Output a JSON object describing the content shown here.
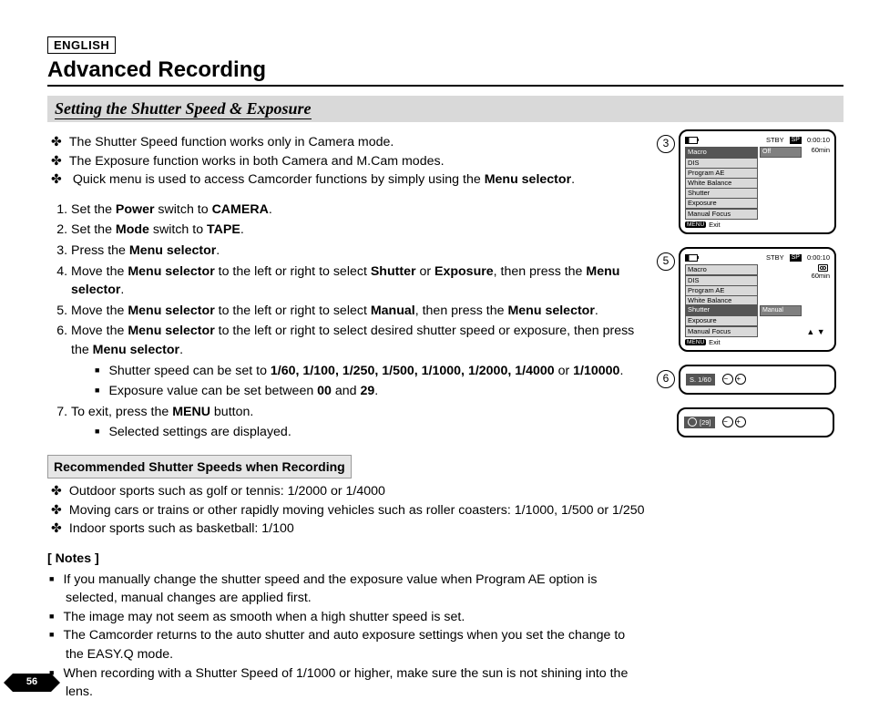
{
  "language_tag": "ENGLISH",
  "title": "Advanced Recording",
  "subtitle": "Setting the Shutter Speed & Exposure",
  "intro": [
    "The Shutter Speed function works only in Camera mode.",
    "The Exposure function works in both Camera and M.Cam modes."
  ],
  "intro3_pre": "Quick menu is used to access Camcorder functions by simply using the ",
  "intro3_bold": "Menu selector",
  "steps": {
    "s1_a": "Set the ",
    "s1_b": "Power",
    "s1_c": " switch to ",
    "s1_d": "CAMERA",
    "s1_e": ".",
    "s2_a": "Set the ",
    "s2_b": "Mode",
    "s2_c": " switch to ",
    "s2_d": "TAPE",
    "s2_e": ".",
    "s3_a": "Press the ",
    "s3_b": "Menu selector",
    "s3_c": ".",
    "s4_a": "Move the ",
    "s4_b": "Menu selector",
    "s4_c": " to the left or right to select ",
    "s4_d": "Shutter",
    "s4_e": " or ",
    "s4_f": "Exposure",
    "s4_g": ", then press the ",
    "s4_h": "Menu selector",
    "s4_i": ".",
    "s5_a": "Move the ",
    "s5_b": "Menu selector",
    "s5_c": " to the left or right to select ",
    "s5_d": "Manual",
    "s5_e": ", then press the ",
    "s5_f": "Menu selector",
    "s5_g": ".",
    "s6_a": "Move the ",
    "s6_b": "Menu selector",
    "s6_c": " to the left or right to select desired shutter speed or exposure, then press the ",
    "s6_d": "Menu selector",
    "s6_e": ".",
    "s6sub1_a": "Shutter speed can be set to ",
    "s6sub1_vals": "1/60, 1/100, 1/250, 1/500, 1/1000, 1/2000, 1/4000",
    "s6sub1_or": " or ",
    "s6sub1_last": "1/10000",
    "s6sub1_dot": ".",
    "s6sub2_a": "Exposure value can be set between ",
    "s6sub2_b": "00",
    "s6sub2_c": " and ",
    "s6sub2_d": "29",
    "s6sub2_e": ".",
    "s7_a": "To exit, press the ",
    "s7_b": "MENU",
    "s7_c": " button.",
    "s7sub": "Selected settings are displayed."
  },
  "rec_heading": "Recommended Shutter Speeds when Recording",
  "rec_items": [
    "Outdoor sports such as golf or tennis: 1/2000 or 1/4000",
    "Moving cars or trains or other rapidly moving vehicles such as roller coasters: 1/1000, 1/500 or 1/250",
    "Indoor sports such as basketball: 1/100"
  ],
  "notes_heading": "[ Notes ]",
  "notes": [
    "If you manually change the shutter speed and the exposure value when Program AE option is selected, manual changes are applied first.",
    "The image may not seem as smooth when a high shutter speed is set.",
    "The Camcorder returns to the auto shutter and auto exposure settings when you set the change to the EASY.Q mode.",
    "When recording with a Shutter Speed of 1/1000 or higher, make sure the sun is not shining into the lens."
  ],
  "page_number": "56",
  "screens": {
    "s3": {
      "num": "3",
      "stby": "STBY",
      "sp": "SP",
      "time": "0:00:10",
      "remain": "60min",
      "items": [
        "Macro",
        "DIS",
        "Program AE",
        "White Balance",
        "Shutter",
        "Exposure",
        "Manual Focus"
      ],
      "sel_index": 0,
      "sel_value": "Off",
      "menu_label": "MENU",
      "exit": "Exit"
    },
    "s5": {
      "num": "5",
      "stby": "STBY",
      "sp": "SP",
      "time": "0:00:10",
      "remain": "60min",
      "items": [
        "Macro",
        "DIS",
        "Program AE",
        "White Balance",
        "Shutter",
        "Exposure",
        "Manual Focus"
      ],
      "sel_index": 4,
      "sel_value": "Manual",
      "menu_label": "MENU",
      "exit": "Exit",
      "arrows": "▲  ▼"
    },
    "s6a": {
      "num": "6",
      "label": "S. 1/60"
    },
    "s6b": {
      "label": "[29]"
    }
  }
}
